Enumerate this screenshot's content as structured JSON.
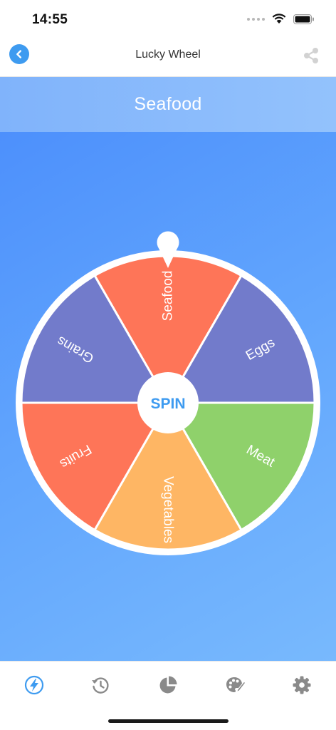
{
  "status_bar": {
    "time": "14:55"
  },
  "nav": {
    "title": "Lucky Wheel"
  },
  "result": {
    "text": "Seafood"
  },
  "wheel": {
    "spin_label": "SPIN",
    "segments": [
      {
        "label": "Seafood",
        "color": "#fe7558"
      },
      {
        "label": "Eggs",
        "color": "#727bcb"
      },
      {
        "label": "Meat",
        "color": "#8fd16b"
      },
      {
        "label": "Vegetables",
        "color": "#feb664"
      },
      {
        "label": "Fruits",
        "color": "#fe7558"
      },
      {
        "label": "Grains",
        "color": "#727bcb"
      }
    ]
  },
  "tabs": [
    {
      "name": "spin-tab",
      "icon": "lightning-icon",
      "active": true
    },
    {
      "name": "history-tab",
      "icon": "history-icon",
      "active": false
    },
    {
      "name": "stats-tab",
      "icon": "pie-chart-icon",
      "active": false
    },
    {
      "name": "theme-tab",
      "icon": "palette-icon",
      "active": false
    },
    {
      "name": "settings-tab",
      "icon": "gear-icon",
      "active": false
    }
  ],
  "colors": {
    "accent": "#3e9bf0",
    "inactive_icon": "#8a8a8a"
  }
}
